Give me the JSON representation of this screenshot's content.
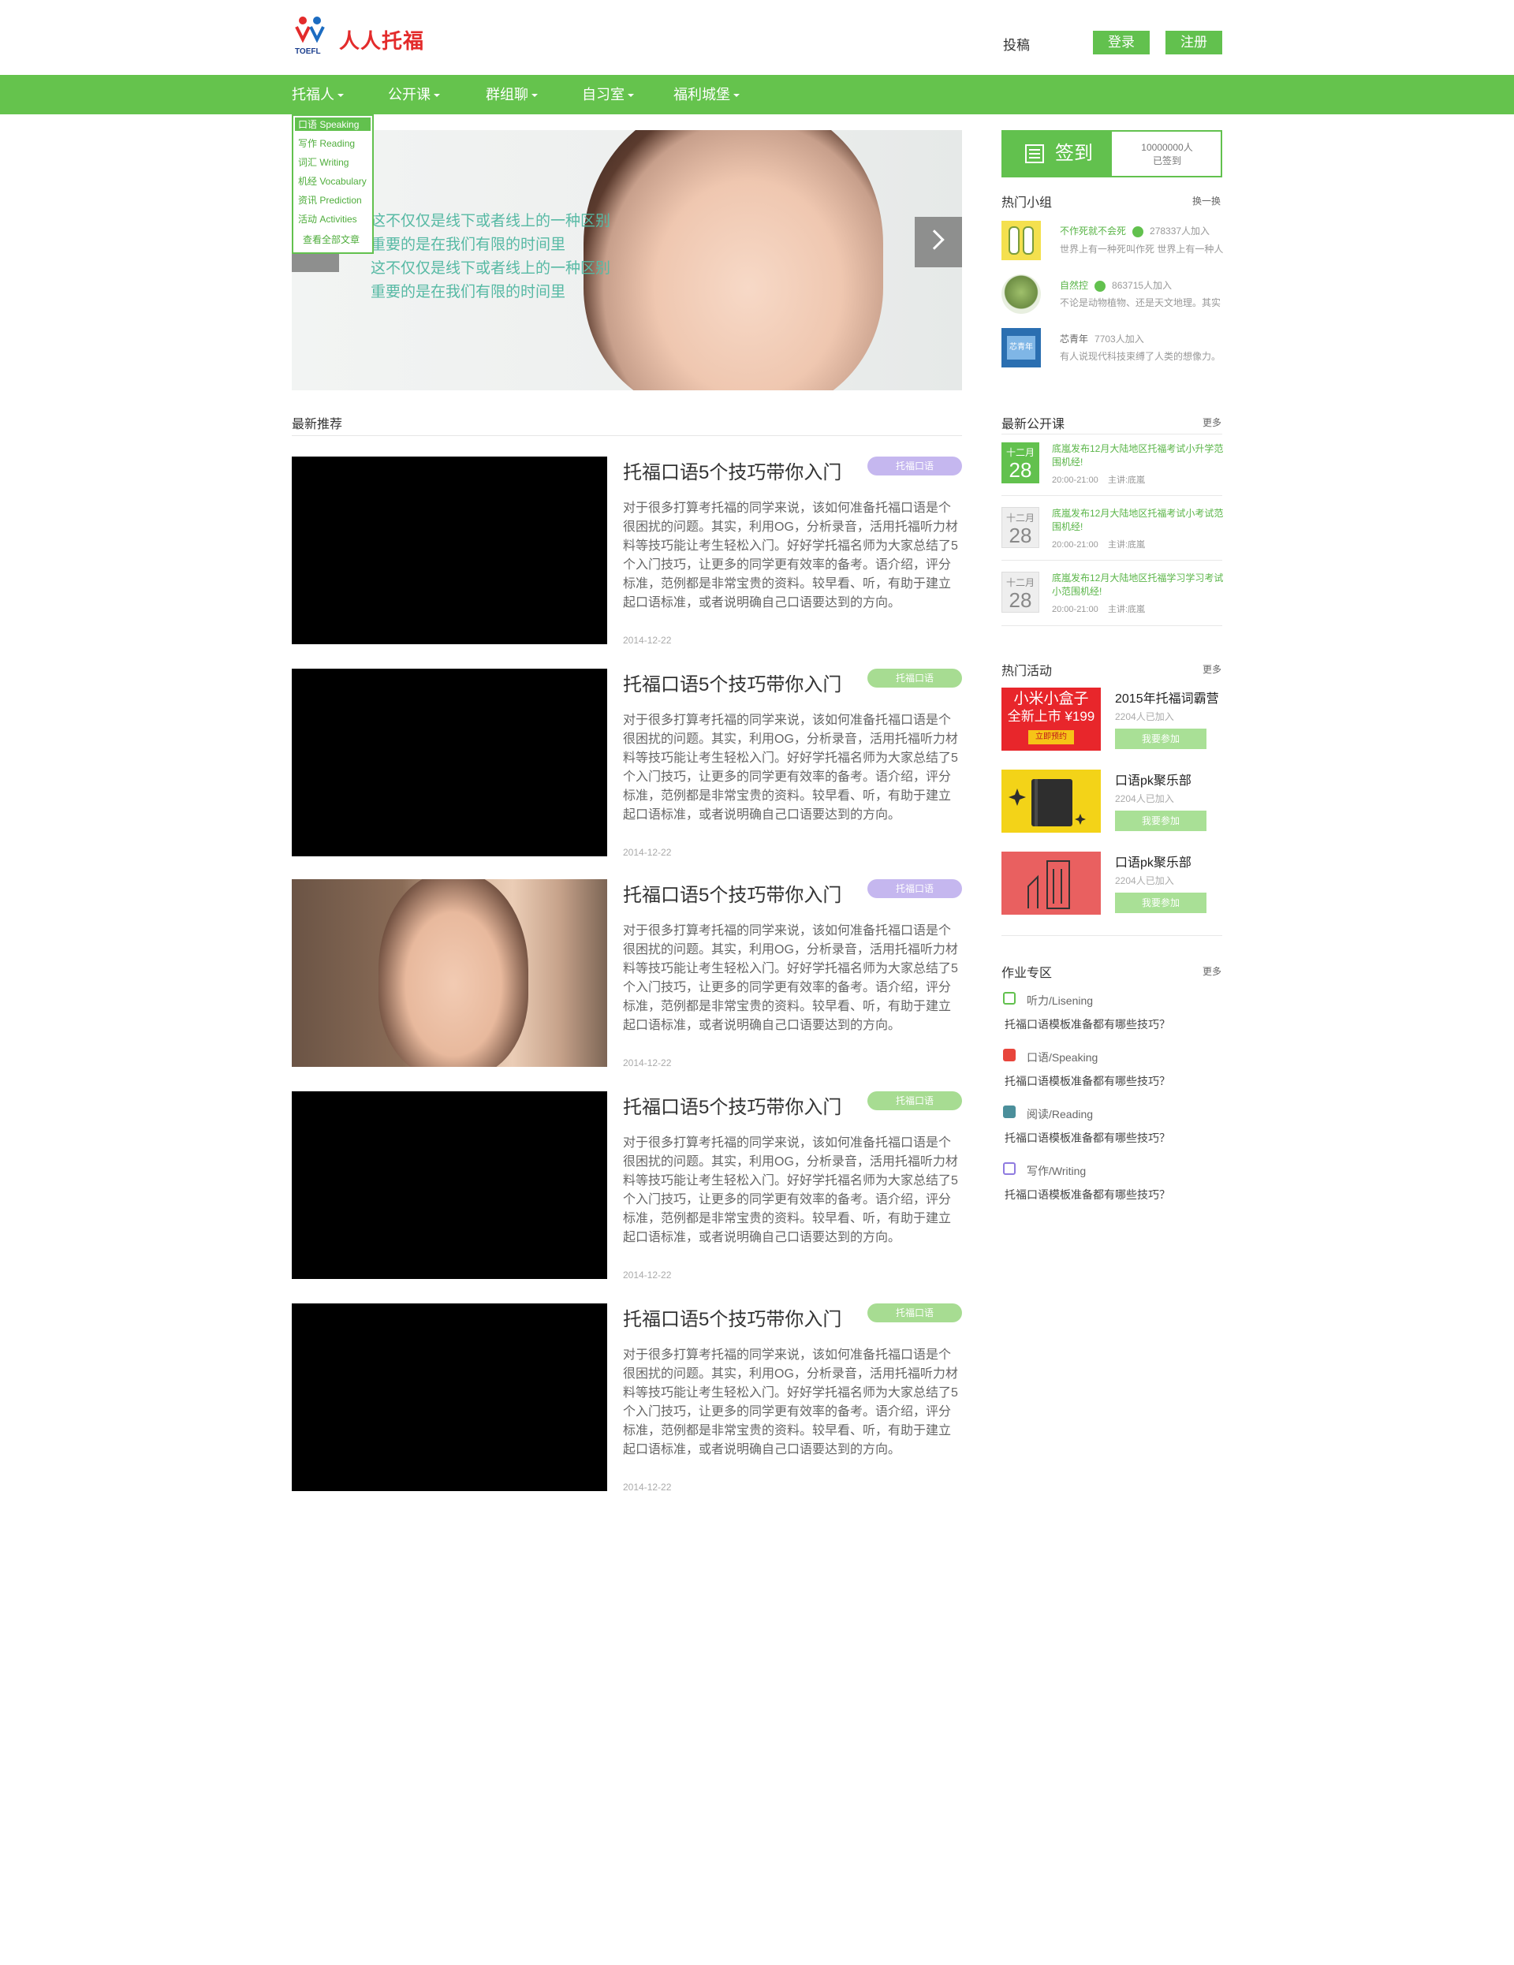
{
  "header": {
    "logo_text": "人人托福",
    "logo_sub": "TOEFL",
    "submit": "投稿",
    "login": "登录",
    "register": "注册"
  },
  "nav": [
    {
      "label": "托福人"
    },
    {
      "label": "公开课"
    },
    {
      "label": "群组聊"
    },
    {
      "label": "自习室"
    },
    {
      "label": "福利城堡"
    }
  ],
  "dropdown": [
    "口语 Speaking",
    "写作 Reading",
    "词汇 Writing",
    "机经 Vocabulary",
    "资讯 Prediction",
    "活动 Activities",
    "查看全部文章"
  ],
  "banner": {
    "lines": [
      "这不仅仅是线下或者线上的一种区别",
      "重要的是在我们有限的时间里",
      "这不仅仅是线下或者线上的一种区别",
      "重要的是在我们有限的时间里"
    ]
  },
  "recommend": {
    "title": "最新推荐",
    "articles": [
      {
        "title": "托福口语5个技巧带你入门",
        "tag": "托福口语",
        "tag_color": "#c5b7ef",
        "date": "2014-12-22",
        "body": "对于很多打算考托福的同学来说，该如何准备托福口语是个很困扰的问题。其实，利用OG，分析录音，活用托福听力材料等技巧能让考生轻松入门。好好学托福名师为大家总结了5个入门技巧，让更多的同学更有效率的备考。语介绍，评分标准，范例都是非常宝贵的资料。较早看、听，有助于建立起口语标准，或者说明确自己口语要达到的方向。"
      },
      {
        "title": "托福口语5个技巧带你入门",
        "tag": "托福口语",
        "tag_color": "#a7dc92",
        "date": "2014-12-22",
        "body": "对于很多打算考托福的同学来说，该如何准备托福口语是个很困扰的问题。其实，利用OG，分析录音，活用托福听力材料等技巧能让考生轻松入门。好好学托福名师为大家总结了5个入门技巧，让更多的同学更有效率的备考。语介绍，评分标准，范例都是非常宝贵的资料。较早看、听，有助于建立起口语标准，或者说明确自己口语要达到的方向。"
      },
      {
        "title": "托福口语5个技巧带你入门",
        "tag": "托福口语",
        "tag_color": "#c5b7ef",
        "date": "2014-12-22",
        "body": "对于很多打算考托福的同学来说，该如何准备托福口语是个很困扰的问题。其实，利用OG，分析录音，活用托福听力材料等技巧能让考生轻松入门。好好学托福名师为大家总结了5个入门技巧，让更多的同学更有效率的备考。语介绍，评分标准，范例都是非常宝贵的资料。较早看、听，有助于建立起口语标准，或者说明确自己口语要达到的方向。"
      },
      {
        "title": "托福口语5个技巧带你入门",
        "tag": "托福口语",
        "tag_color": "#a7dc92",
        "date": "2014-12-22",
        "body": "对于很多打算考托福的同学来说，该如何准备托福口语是个很困扰的问题。其实，利用OG，分析录音，活用托福听力材料等技巧能让考生轻松入门。好好学托福名师为大家总结了5个入门技巧，让更多的同学更有效率的备考。语介绍，评分标准，范例都是非常宝贵的资料。较早看、听，有助于建立起口语标准，或者说明确自己口语要达到的方向。"
      },
      {
        "title": "托福口语5个技巧带你入门",
        "tag": "托福口语",
        "tag_color": "#a7dc92",
        "date": "2014-12-22",
        "body": "对于很多打算考托福的同学来说，该如何准备托福口语是个很困扰的问题。其实，利用OG，分析录音，活用托福听力材料等技巧能让考生轻松入门。好好学托福名师为大家总结了5个入门技巧，让更多的同学更有效率的备考。语介绍，评分标准，范例都是非常宝贵的资料。较早看、听，有助于建立起口语标准，或者说明确自己口语要达到的方向。"
      }
    ]
  },
  "signin": {
    "label": "签到",
    "count": "10000000人",
    "status": "已签到"
  },
  "groups": {
    "title": "热门小组",
    "more": "换一换",
    "items": [
      {
        "name": "不作死就不会死",
        "count": "278337人加入",
        "desc": "世界上有一种死叫作死 世界上有一种人"
      },
      {
        "name": "自然控",
        "count": "863715人加入",
        "desc": "不论是动物植物、还是天文地理。其实"
      },
      {
        "name": "芯青年",
        "count": "7703人加入",
        "desc": "有人说现代科技束缚了人类的想像力。",
        "avatar_label": "芯青年"
      }
    ]
  },
  "courses": {
    "title": "最新公开课",
    "more": "更多",
    "items": [
      {
        "month": "十二月",
        "day": "28",
        "title": "底嵐发布12月大陆地区托福考试小升学范围机经!",
        "time": "20:00-21:00",
        "host": "主讲:底嵐"
      },
      {
        "month": "十二月",
        "day": "28",
        "title": "底嵐发布12月大陆地区托福考试小考试范围机经!",
        "time": "20:00-21:00",
        "host": "主讲:底嵐"
      },
      {
        "month": "十二月",
        "day": "28",
        "title": "底嵐发布12月大陆地区托福学习学习考试小范围机经!",
        "time": "20:00-21:00",
        "host": "主讲:底嵐"
      }
    ]
  },
  "activities": {
    "title": "热门活动",
    "more": "更多",
    "items": [
      {
        "title": "2015年托福词霸营",
        "count": "2204人已加入",
        "button": "我要参加",
        "img_line1": "小米小盒子",
        "img_line2": "全新上市 ¥199",
        "img_btn": "立即预约"
      },
      {
        "title": "口语pk聚乐部",
        "count": "2204人已加入",
        "button": "我要参加"
      },
      {
        "title": "口语pk聚乐部",
        "count": "2204人已加入",
        "button": "我要参加"
      }
    ]
  },
  "homework": {
    "title": "作业专区",
    "more": "更多",
    "items": [
      {
        "label": "听力/Lisening",
        "question": "托福口语模板准备都有哪些技巧？",
        "color": "#62c14e"
      },
      {
        "label": "口语/Speaking",
        "question": "托福口语模板准备都有哪些技巧？",
        "color": "#e8453c"
      },
      {
        "label": "阅读/Reading",
        "question": "托福口语模板准备都有哪些技巧？",
        "color": "#4b8f9b"
      },
      {
        "label": "写作/Writing",
        "question": "托福口语模板准备都有哪些技巧？",
        "color": "#8f7be0"
      }
    ]
  }
}
